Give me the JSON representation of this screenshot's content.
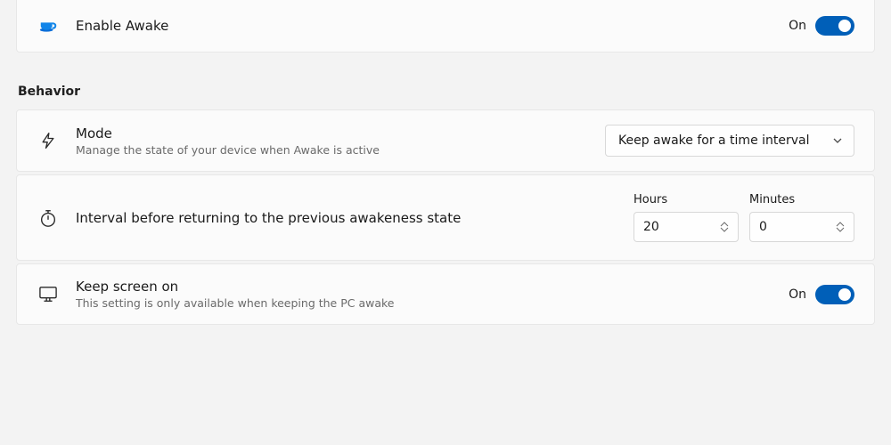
{
  "enable": {
    "title": "Enable Awake",
    "status": "On"
  },
  "section_behavior_title": "Behavior",
  "mode": {
    "title": "Mode",
    "sub": "Manage the state of your device when Awake is active",
    "selected": "Keep awake for a time interval"
  },
  "interval": {
    "title": "Interval before returning to the previous awakeness state",
    "hours_label": "Hours",
    "minutes_label": "Minutes",
    "hours_value": "20",
    "minutes_value": "0"
  },
  "keep_screen": {
    "title": "Keep screen on",
    "sub": "This setting is only available when keeping the PC awake",
    "status": "On"
  }
}
